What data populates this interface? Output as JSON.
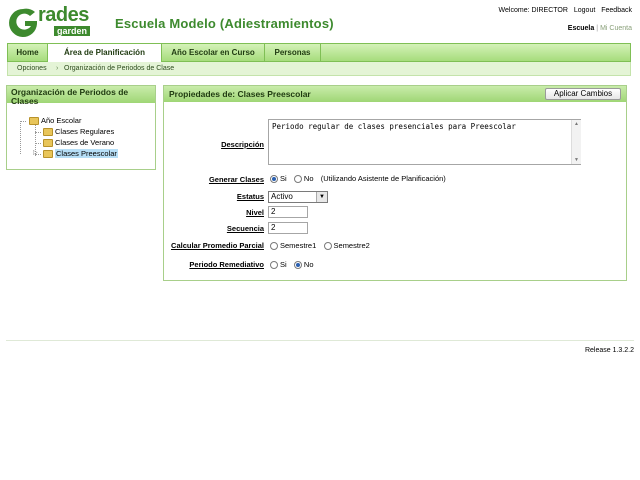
{
  "header": {
    "logo_main": "rades",
    "logo_sub": "garden",
    "school_title": "Escuela Modelo (Adiestramientos)",
    "welcome": "Welcome: DIRECTOR",
    "logout": "Logout",
    "feedback": "Feedback",
    "context_selected": "Escuela",
    "context_separator": "|",
    "context_other": "Mi Cuenta"
  },
  "nav": {
    "tabs": [
      {
        "label": "Home"
      },
      {
        "label": "Área de Planificación"
      },
      {
        "label": "Año Escolar en Curso"
      },
      {
        "label": "Personas"
      }
    ]
  },
  "breadcrumb": {
    "items": [
      "Opciones",
      "Organización de Periodos de Clase"
    ],
    "separator": "›"
  },
  "left_panel": {
    "title": "Organización de Periodos de Clases",
    "tree": {
      "root": "Año Escolar",
      "children": [
        "Clases Regulares",
        "Clases de Verano",
        "Clases Preescolar"
      ],
      "selected": "Clases Preescolar"
    }
  },
  "right_panel": {
    "title": "Propiedades de: Clases Preescolar",
    "apply_label": "Aplicar Cambios",
    "fields": {
      "descripcion_label": "Descripción",
      "descripcion_value": "Periodo regular de clases presenciales para Preescolar",
      "generar_label": "Generar Clases",
      "generar_si": "Si",
      "generar_no": "No",
      "generar_note": "(Utilizando Asistente de Planificación)",
      "estatus_label": "Estatus",
      "estatus_value": "Activo",
      "nivel_label": "Nivel",
      "nivel_value": "2",
      "secuencia_label": "Secuencia",
      "secuencia_value": "2",
      "promedio_label": "Calcular Promedio Parcial",
      "promedio_opt1": "Semestre1",
      "promedio_opt2": "Semestre2",
      "remediativo_label": "Periodo Remediativo",
      "remediativo_si": "Si",
      "remediativo_no": "No"
    }
  },
  "footer": {
    "release": "Release 1.3.2.2"
  },
  "colors": {
    "brand_green": "#3d8a2e",
    "nav_bg": "#a6dc7c",
    "selection_blue": "#b7dff7"
  }
}
